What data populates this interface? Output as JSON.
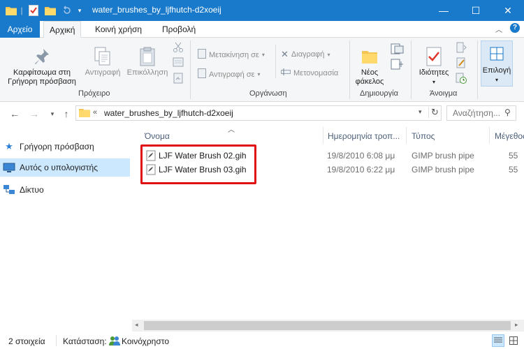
{
  "window": {
    "title": "water_brushes_by_ljfhutch-d2xoeij",
    "minimize": "—",
    "maximize": "☐",
    "close": "✕"
  },
  "ribbon_tabs": [
    {
      "label": "Αρχείο"
    },
    {
      "label": "Αρχική"
    },
    {
      "label": "Κοινή χρήση"
    },
    {
      "label": "Προβολή"
    }
  ],
  "ribbon": {
    "clipboard": {
      "pin_label_1": "Καρφίτσωμα στη",
      "pin_label_2": "Γρήγορη πρόσβαση",
      "copy_label": "Αντιγραφή",
      "paste_label": "Επικόλληση",
      "group_title": "Πρόχειρο"
    },
    "organize": {
      "move_label": "Μετακίνηση σε",
      "copy_to_label": "Αντιγραφή σε",
      "delete_label": "Διαγραφή",
      "rename_label": "Μετονομασία",
      "group_title": "Οργάνωση"
    },
    "new": {
      "folder_label_1": "Νέος",
      "folder_label_2": "φάκελος",
      "group_title": "Δημιουργία"
    },
    "open": {
      "properties_label": "Ιδιότητες",
      "group_title": "Άνοιγμα"
    },
    "select": {
      "select_label": "Επιλογή"
    }
  },
  "address": {
    "chevron": "«",
    "path": "water_brushes_by_ljfhutch-d2xoeij",
    "search_placeholder": "Αναζήτηση..."
  },
  "nav": [
    {
      "label": "Γρήγορη πρόσβαση"
    },
    {
      "label": "Αυτός ο υπολογιστής"
    },
    {
      "label": "Δίκτυο"
    }
  ],
  "columns": {
    "name": "Όνομα",
    "date": "Ημερομηνία τροπ...",
    "type": "Τύπος",
    "size": "Μέγεθος"
  },
  "files": [
    {
      "name": "LJF Water Brush 02.gih",
      "date": "19/8/2010 6:08 μμ",
      "type": "GIMP brush pipe",
      "size": "55"
    },
    {
      "name": "LJF Water Brush 03.gih",
      "date": "19/8/2010 6:22 μμ",
      "type": "GIMP brush pipe",
      "size": "55"
    }
  ],
  "status": {
    "count": "2 στοιχεία",
    "state_label": "Κατάσταση:",
    "state_value": "Κοινόχρηστο"
  },
  "colors": {
    "title_bar": "#1979ca",
    "selection": "#cce8ff",
    "highlight_box": "#e01010"
  }
}
